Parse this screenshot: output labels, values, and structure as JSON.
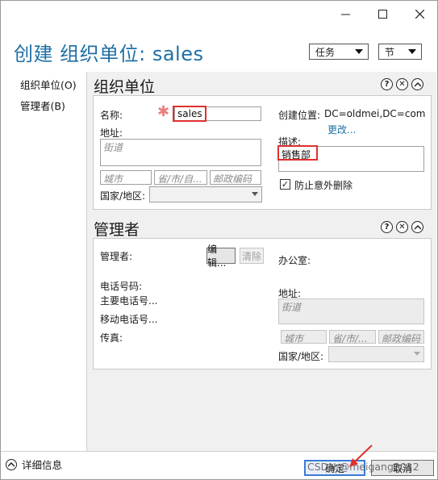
{
  "window": {
    "title": "创建 组织单位: sales",
    "header_dropdowns": {
      "tasks": "任务",
      "section": "节"
    }
  },
  "nav": {
    "items": [
      {
        "label": "组织单位(O)"
      },
      {
        "label": "管理者(B)"
      }
    ]
  },
  "org_unit": {
    "section_title": "组织单位",
    "name_label": "名称:",
    "name_value": "sales",
    "address_label": "地址:",
    "street_placeholder": "街道",
    "city_placeholder": "城市",
    "province_placeholder": "省/市/自...",
    "postal_placeholder": "邮政编码",
    "country_label": "国家/地区:",
    "create_location_label": "创建位置:",
    "create_location_value": "DC=oldmei,DC=com",
    "change_link": "更改...",
    "description_label": "描述:",
    "description_value": "销售部",
    "protect_checkbox_label": "防止意外删除",
    "protect_checked": true
  },
  "manager": {
    "section_title": "管理者",
    "manager_label": "管理者:",
    "edit_button": "编辑...",
    "clear_button": "清除",
    "office_label": "办公室:",
    "phone_label": "电话号码:",
    "main_phone": "主要电话号...",
    "mobile_phone": "移动电话号...",
    "fax_label": "传真:",
    "address_label": "地址:",
    "street_placeholder": "街道",
    "city_placeholder": "城市",
    "province_placeholder": "省/市/...",
    "postal_placeholder": "邮政编码",
    "country_label": "国家/地区:"
  },
  "footer": {
    "details_label": "详细信息",
    "ok_button": "确定",
    "cancel_button": "取消",
    "watermark": "CSDN @meigang2012"
  },
  "colors": {
    "title_blue": "#1f6fa5",
    "highlight_red": "#e03030",
    "section_bg": "#f0f0f0"
  }
}
